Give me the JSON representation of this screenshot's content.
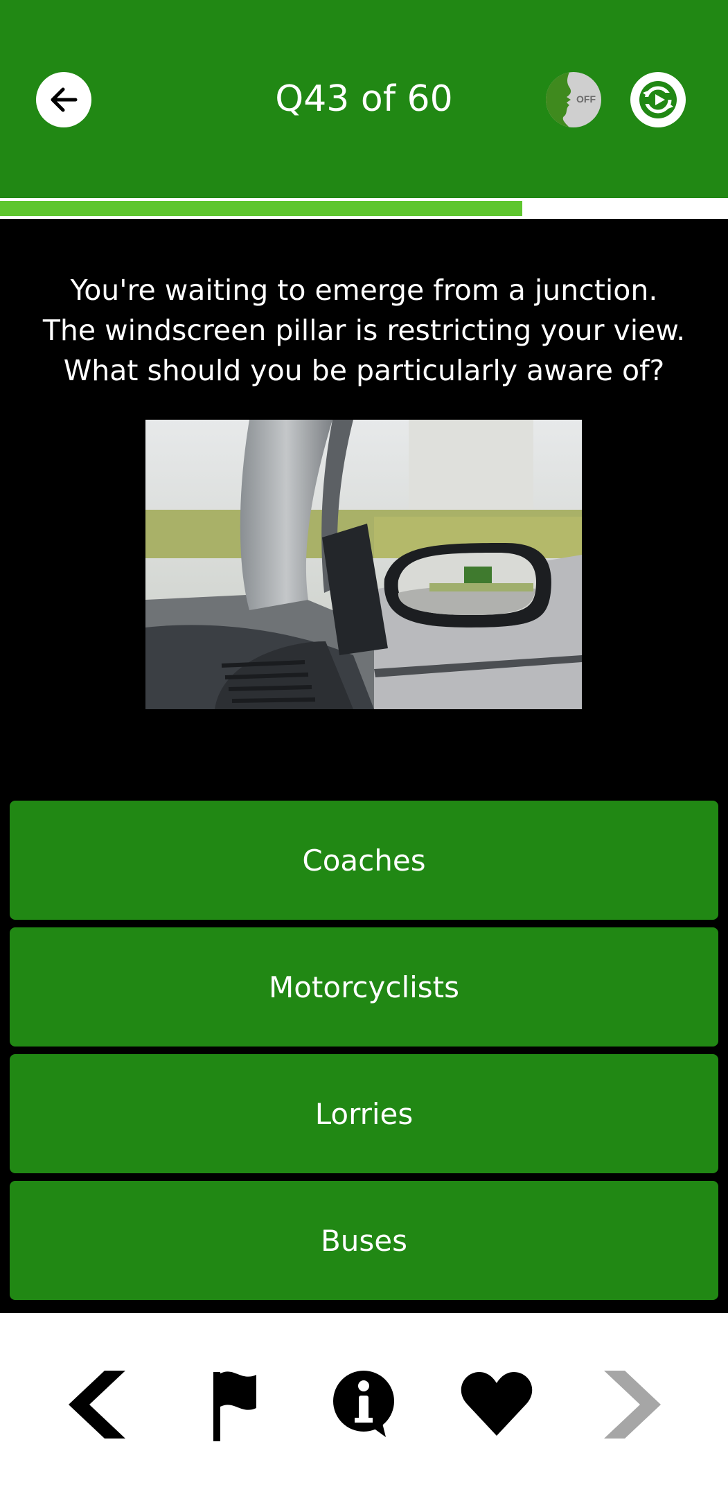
{
  "header": {
    "title": "Q43 of 60",
    "back_icon": "arrow-left-icon",
    "voice_toggle": {
      "icon": "voice-toggle-icon",
      "state_label": "OFF"
    },
    "replay_icon": "replay-icon"
  },
  "progress": {
    "current": 43,
    "total": 60,
    "fraction": 0.717
  },
  "question": {
    "text": "You're waiting to emerge from a junction.\nThe windscreen pillar is restricting your view.\nWhat should you be particularly aware of?"
  },
  "answers": [
    {
      "label": "Coaches"
    },
    {
      "label": "Motorcyclists"
    },
    {
      "label": "Lorries"
    },
    {
      "label": "Buses"
    }
  ],
  "footer_nav": {
    "prev_icon": "chevron-left-icon",
    "flag_icon": "flag-icon",
    "info_icon": "info-icon",
    "favorite_icon": "heart-icon",
    "next_icon": "chevron-right-icon"
  },
  "colors": {
    "header_green": "#218814",
    "progress_green": "#5ec62e",
    "background": "#000000",
    "next_disabled": "#a6a6a6"
  }
}
